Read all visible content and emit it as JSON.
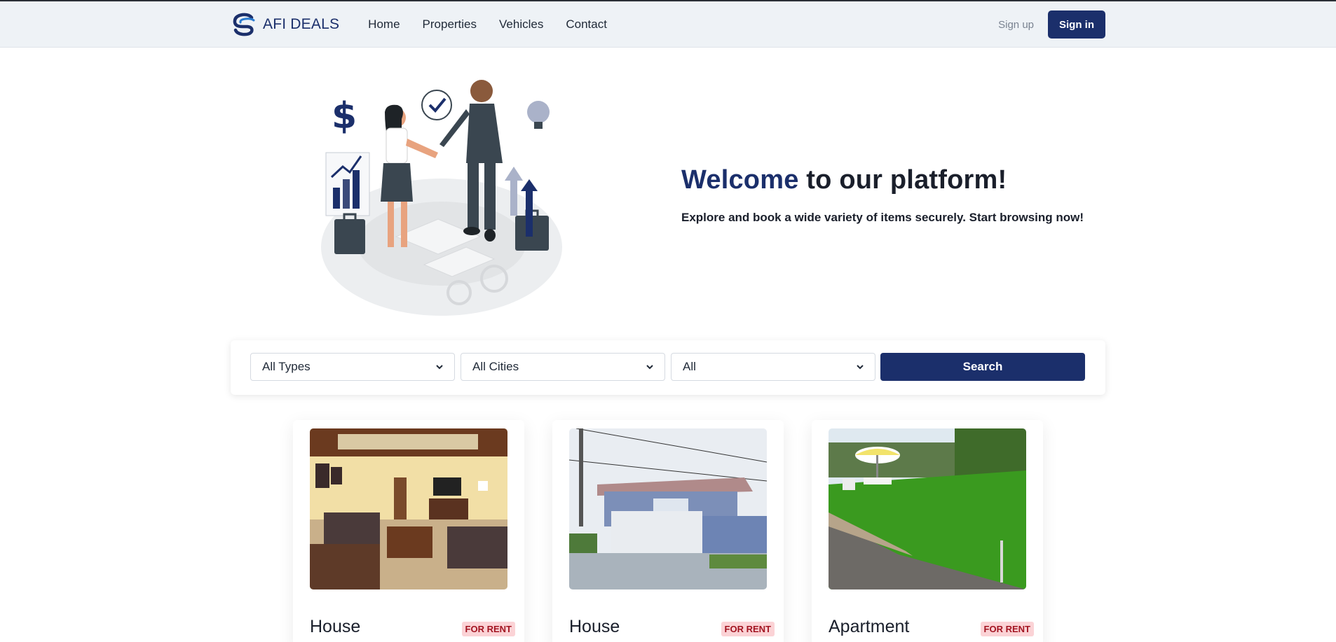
{
  "brand": {
    "name": "AFI DEALS",
    "color": "#1b2f6b"
  },
  "nav": {
    "links": [
      "Home",
      "Properties",
      "Vehicles",
      "Contact"
    ],
    "signup_label": "Sign up",
    "signin_label": "Sign in"
  },
  "hero": {
    "title_accent": "Welcome",
    "title_rest": " to our platform!",
    "subtitle": "Explore and book a wide variety of items securely. Start browsing now!"
  },
  "search": {
    "type_value": "All Types",
    "city_value": "All Cities",
    "status_value": "All",
    "button_label": "Search"
  },
  "listings": [
    {
      "title": "House",
      "badge": "FOR RENT",
      "image": "living-room-photo"
    },
    {
      "title": "House",
      "badge": "FOR RENT",
      "image": "house-exterior-photo"
    },
    {
      "title": "Apartment",
      "badge": "FOR RENT",
      "image": "garden-lawn-photo"
    }
  ]
}
